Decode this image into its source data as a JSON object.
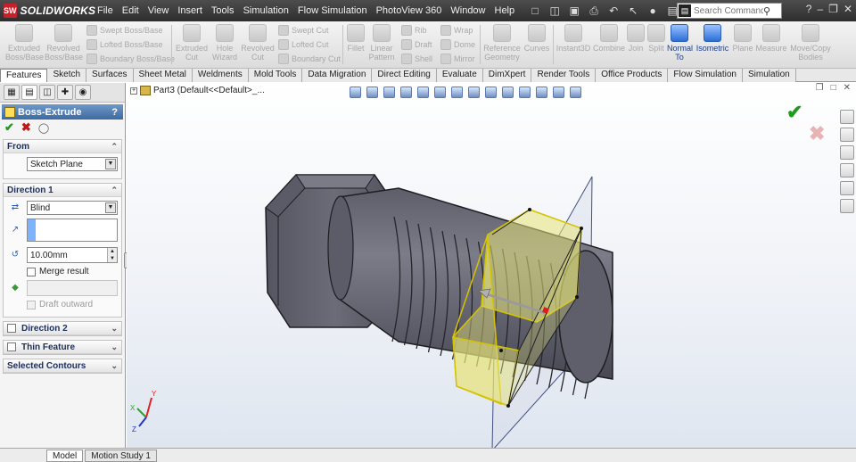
{
  "app": {
    "logo": "SW",
    "brand": "SOLIDWORKS"
  },
  "menu": [
    "File",
    "Edit",
    "View",
    "Insert",
    "Tools",
    "Simulation",
    "Flow Simulation",
    "PhotoView 360",
    "Window",
    "Help"
  ],
  "search": {
    "placeholder": "Search Commands"
  },
  "command_manager": {
    "big": [
      {
        "label": "Extruded Boss/Base",
        "icon": "extruded-boss-icon"
      },
      {
        "label": "Revolved Boss/Base",
        "icon": "revolved-boss-icon"
      },
      {
        "label": "Extruded Cut",
        "icon": "extruded-cut-icon"
      },
      {
        "label": "Hole Wizard",
        "icon": "hole-wizard-icon"
      },
      {
        "label": "Revolved Cut",
        "icon": "revolved-cut-icon"
      },
      {
        "label": "Fillet",
        "icon": "fillet-icon"
      },
      {
        "label": "Linear Pattern",
        "icon": "linear-pattern-icon"
      },
      {
        "label": "Reference Geometry",
        "icon": "reference-geometry-icon"
      },
      {
        "label": "Curves",
        "icon": "curves-icon"
      },
      {
        "label": "Instant3D",
        "icon": "instant3d-icon"
      },
      {
        "label": "Combine",
        "icon": "combine-icon"
      },
      {
        "label": "Join",
        "icon": "join-icon"
      },
      {
        "label": "Split",
        "icon": "split-icon"
      },
      {
        "label": "Normal To",
        "icon": "normal-to-icon"
      },
      {
        "label": "Isometric",
        "icon": "isometric-icon"
      },
      {
        "label": "Plane",
        "icon": "plane-icon"
      },
      {
        "label": "Measure",
        "icon": "measure-icon"
      },
      {
        "label": "Move/Copy Bodies",
        "icon": "move-copy-icon"
      }
    ],
    "small": [
      {
        "label": "Swept Boss/Base"
      },
      {
        "label": "Lofted Boss/Base"
      },
      {
        "label": "Boundary Boss/Base"
      },
      {
        "label": "Swept Cut"
      },
      {
        "label": "Lofted Cut"
      },
      {
        "label": "Boundary Cut"
      },
      {
        "label": "Rib"
      },
      {
        "label": "Draft"
      },
      {
        "label": "Shell"
      },
      {
        "label": "Wrap"
      },
      {
        "label": "Dome"
      },
      {
        "label": "Mirror"
      }
    ]
  },
  "tabs": [
    "Features",
    "Sketch",
    "Surfaces",
    "Sheet Metal",
    "Weldments",
    "Mold Tools",
    "Data Migration",
    "Direct Editing",
    "Evaluate",
    "DimXpert",
    "Render Tools",
    "Office Products",
    "Flow Simulation",
    "Simulation"
  ],
  "property_manager": {
    "title": "Boss-Extrude",
    "help": "?",
    "from": {
      "header": "From",
      "value": "Sketch Plane"
    },
    "direction1": {
      "header": "Direction 1",
      "end_condition": "Blind",
      "depth": "10.00mm",
      "merge_result": "Merge result",
      "draft_outward": "Draft outward"
    },
    "direction2": {
      "header": "Direction 2"
    },
    "thin_feature": {
      "header": "Thin Feature"
    },
    "selected_contours": {
      "header": "Selected Contours"
    }
  },
  "viewport": {
    "tree_label": "Part3  (Default<<Default>_..."
  },
  "bottom_tabs": [
    "Model",
    "Motion Study 1"
  ],
  "triad": {
    "x": "X",
    "y": "Y",
    "z": "Z"
  },
  "colors": {
    "accent": "#2a6ed8",
    "model": "#6c6d78",
    "preview": "#e6e37a",
    "menu": "#3a3a3a"
  }
}
